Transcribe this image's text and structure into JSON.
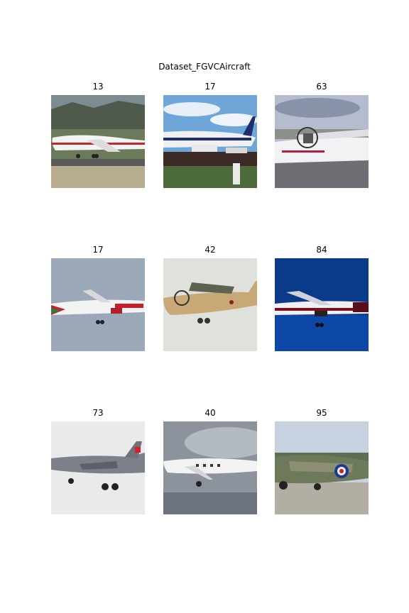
{
  "figure": {
    "title": "Dataset_FGVCAircraft",
    "images": [
      {
        "label": "13",
        "icon": "jumbo-jet-on-runway-photo"
      },
      {
        "label": "17",
        "icon": "airliner-at-gate-photo"
      },
      {
        "label": "63",
        "icon": "turboprop-on-apron-photo"
      },
      {
        "label": "17",
        "icon": "airliner-in-flight-photo"
      },
      {
        "label": "42",
        "icon": "military-transport-photo"
      },
      {
        "label": "84",
        "icon": "airliner-night-sky-photo"
      },
      {
        "label": "73",
        "icon": "fighter-jet-photo"
      },
      {
        "label": "40",
        "icon": "business-turboprop-photo"
      },
      {
        "label": "95",
        "icon": "warbird-on-grass-photo"
      }
    ]
  }
}
